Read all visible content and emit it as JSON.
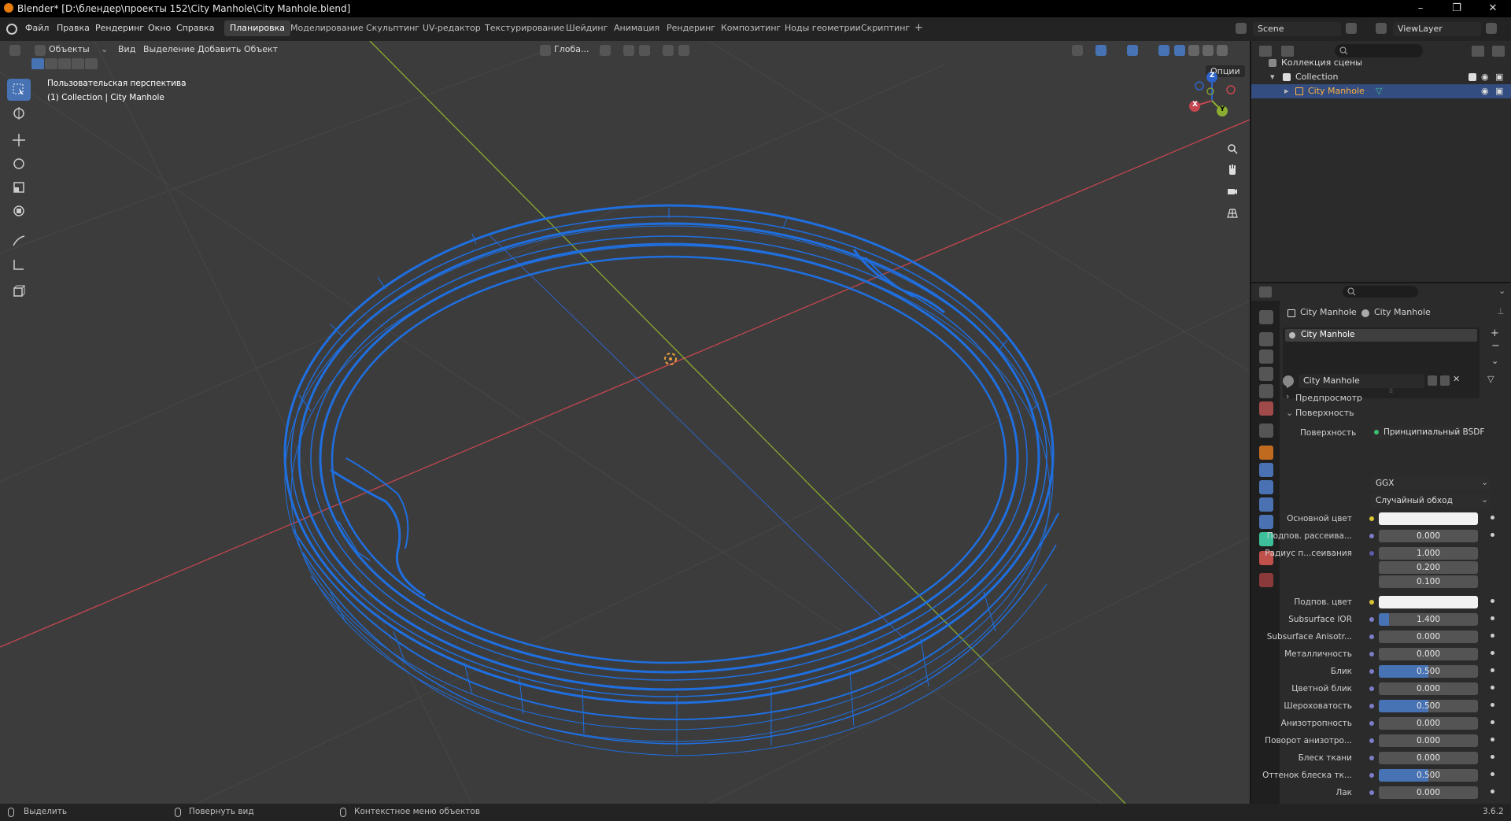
{
  "window": {
    "title": "Blender* [D:\\блендер\\проекты 152\\City Manhole\\City Manhole.blend]",
    "minimize": "–",
    "restore": "❐",
    "close": "✕"
  },
  "menu": {
    "items": [
      "Файл",
      "Правка",
      "Рендеринг",
      "Окно",
      "Справка"
    ]
  },
  "workspaces": {
    "tabs": [
      "Планировка",
      "Моделирование",
      "Скульптинг",
      "UV-редактор",
      "Текстурирование",
      "Шейдинг",
      "Анимация",
      "Рендеринг",
      "Композитинг",
      "Ноды геометрии",
      "Скриптинг"
    ],
    "active": "Планировка",
    "add": "+"
  },
  "scene": {
    "name": "Scene",
    "view_layer": "ViewLayer"
  },
  "viewport": {
    "mode": "Объекты",
    "menus": [
      "Вид",
      "Выделение",
      "Добавить",
      "Объект"
    ],
    "orientation": "Глоба...",
    "options": "Опции",
    "overlay_line1": "Пользовательская перспектива",
    "overlay_line2": "(1) Collection | City Manhole",
    "gizmo": {
      "z": "Z",
      "y": "Y",
      "x": "X"
    },
    "colors": {
      "wire": "#1f6fe0",
      "x_axis": "#c4464f",
      "y_axis": "#8aac30",
      "background": "#3c3c3c",
      "origin": "#e8a13a"
    }
  },
  "outliner": {
    "rows": [
      {
        "label": "Коллекция сцены"
      },
      {
        "label": "Collection"
      },
      {
        "label": "City Manhole"
      }
    ]
  },
  "properties": {
    "breadcrumb": [
      "City Manhole",
      "City Manhole"
    ],
    "slot": "City Manhole",
    "material": "City Manhole",
    "sections": {
      "preview": "Предпросмотр",
      "surface": "Поверхность"
    },
    "surface_label": "Поверхность",
    "surface_value": "Принципиальный BSDF",
    "distribution": "GGX",
    "subsurface_method": "Случайный обход",
    "rows": [
      {
        "label": "Основной цвет",
        "type": "color",
        "dot": "#d8c433",
        "value": ""
      },
      {
        "label": "Подпов. рассеива...",
        "type": "number",
        "dot": "#7c7cc7",
        "value": "0.000",
        "fill": 0
      },
      {
        "label": "Радиус п...сеивания",
        "type": "number",
        "dot": "#5a5aa6",
        "value": "1.000",
        "fill": 0
      },
      {
        "label": "",
        "type": "number",
        "value": "0.200",
        "fill": 0
      },
      {
        "label": "",
        "type": "number",
        "value": "0.100",
        "fill": 0
      },
      {
        "label": "Подпов. цвет",
        "type": "color",
        "dot": "#d8c433",
        "value": ""
      },
      {
        "label": "Subsurface IOR",
        "type": "number",
        "dot": "#7c7cc7",
        "value": "1.400",
        "fill": 0.1
      },
      {
        "label": "Subsurface Anisotr...",
        "type": "number",
        "dot": "#7c7cc7",
        "value": "0.000",
        "fill": 0
      },
      {
        "label": "Металличность",
        "type": "number",
        "dot": "#7c7cc7",
        "value": "0.000",
        "fill": 0
      },
      {
        "label": "Блик",
        "type": "number",
        "dot": "#7c7cc7",
        "value": "0.500",
        "fill": 0.5
      },
      {
        "label": "Цветной блик",
        "type": "number",
        "dot": "#7c7cc7",
        "value": "0.000",
        "fill": 0
      },
      {
        "label": "Шероховатость",
        "type": "number",
        "dot": "#7c7cc7",
        "value": "0.500",
        "fill": 0.5
      },
      {
        "label": "Анизотропность",
        "type": "number",
        "dot": "#7c7cc7",
        "value": "0.000",
        "fill": 0
      },
      {
        "label": "Поворот анизотро...",
        "type": "number",
        "dot": "#7c7cc7",
        "value": "0.000",
        "fill": 0
      },
      {
        "label": "Блеск ткани",
        "type": "number",
        "dot": "#7c7cc7",
        "value": "0.000",
        "fill": 0
      },
      {
        "label": "Оттенок блеска тк...",
        "type": "number",
        "dot": "#7c7cc7",
        "value": "0.500",
        "fill": 0.5
      },
      {
        "label": "Лак",
        "type": "number",
        "dot": "#7c7cc7",
        "value": "0.000",
        "fill": 0
      }
    ]
  },
  "statusbar": {
    "select": "Выделить",
    "rotate": "Повернуть вид",
    "context": "Контекстное меню объектов",
    "version": "3.6.2"
  }
}
